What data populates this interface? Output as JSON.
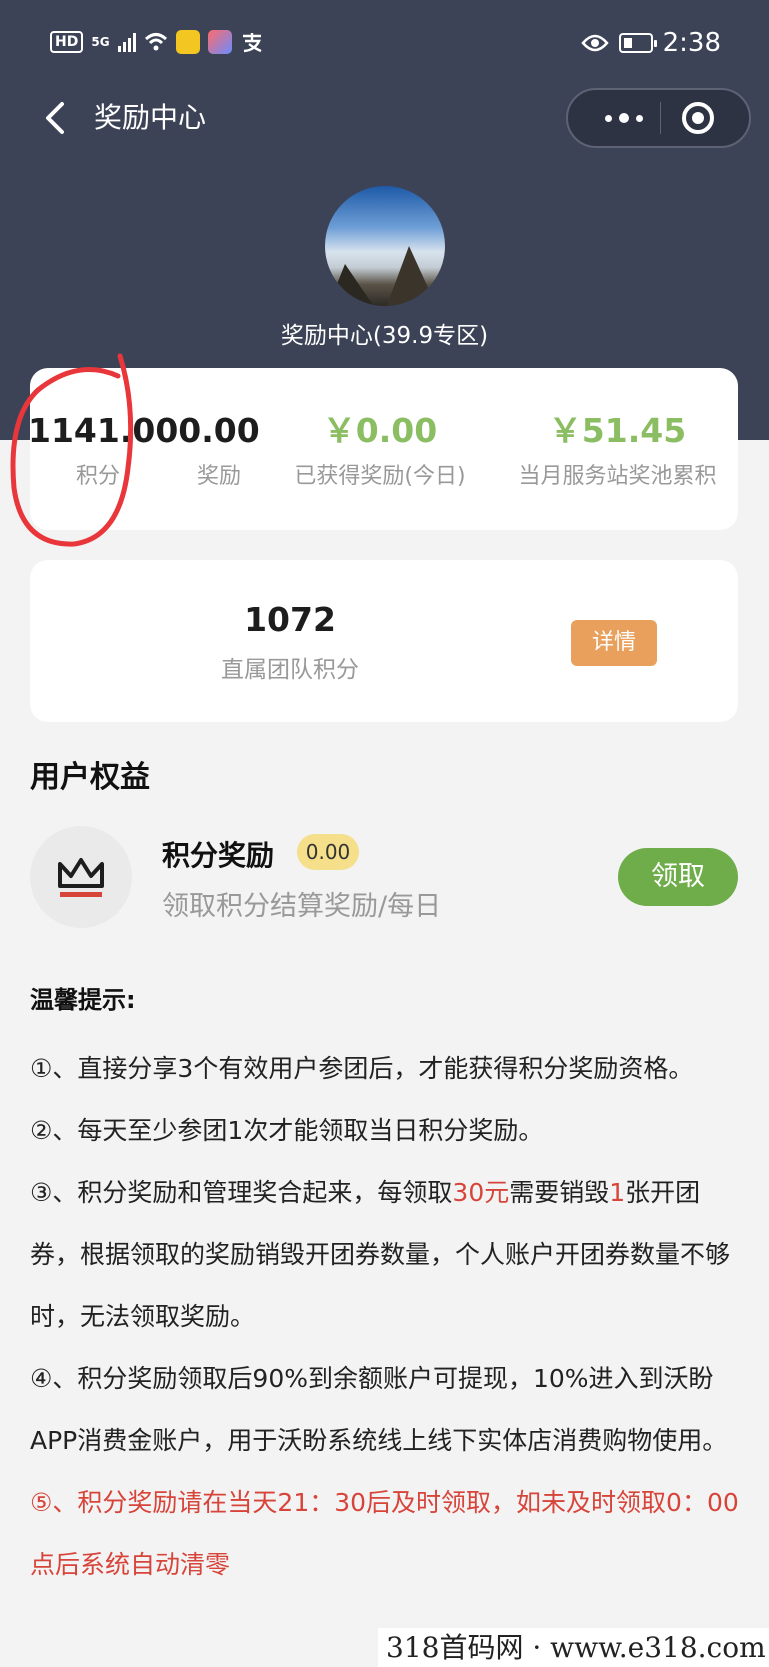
{
  "status_bar": {
    "hd": "HD",
    "network": "5G",
    "time": "2:38",
    "icons": [
      "signal-icon",
      "wifi-icon",
      "app-icon",
      "app-icon",
      "alipay-icon",
      "eye-icon",
      "battery-icon"
    ]
  },
  "nav": {
    "title": "奖励中心",
    "icons": [
      "back-icon",
      "more-icon",
      "target-icon"
    ]
  },
  "profile": {
    "name": "奖励中心(39.9专区)"
  },
  "stats": [
    {
      "value": "1141.00",
      "label": "积分"
    },
    {
      "value": "0.00",
      "label": "奖励"
    },
    {
      "value": "￥0.00",
      "label": "已获得奖励(今日)"
    },
    {
      "value": "￥51.45",
      "label": "当月服务站奖池累积"
    }
  ],
  "team": {
    "value": "1072",
    "label": "直属团队积分",
    "button": "详情"
  },
  "rights": {
    "section_title": "用户权益",
    "item": {
      "title": "积分奖励",
      "badge": "0.00",
      "subtitle": "领取积分结算奖励/每日",
      "button": "领取",
      "icon": "crown-icon"
    }
  },
  "tips": {
    "title": "温馨提示:",
    "t1": "①、直接分享3个有效用户参团后，才能获得积分奖励资格。",
    "t2": "②、每天至少参团1次才能领取当日积分奖励。",
    "t3_a": "③、积分奖励和管理奖合起来，每领取",
    "t3_b": "30元",
    "t3_c": "需要销毁",
    "t3_d": "1",
    "t3_e": "张开团券，根据领取的奖励销毁开团券数量，个人账户开团券数量不够时，无法领取奖励。",
    "t4": "④、积分奖励领取后90%到余额账户可提现，10%进入到沃盼APP消费金账户，用于沃盼系统线上线下实体店消费购物使用。",
    "t5": "⑤、积分奖励请在当天21：30后及时领取，如未及时领取0：00点后系统自动清零"
  },
  "watermark": "318首码网 · www.e318.com",
  "colors": {
    "header": "#3d4357",
    "green_value": "#8bbd62",
    "detail_button": "#e9a05c",
    "claim_button": "#6fad4a",
    "badge": "#f6df8a",
    "red_text": "#d7443a",
    "annotation": "#e8363a"
  }
}
